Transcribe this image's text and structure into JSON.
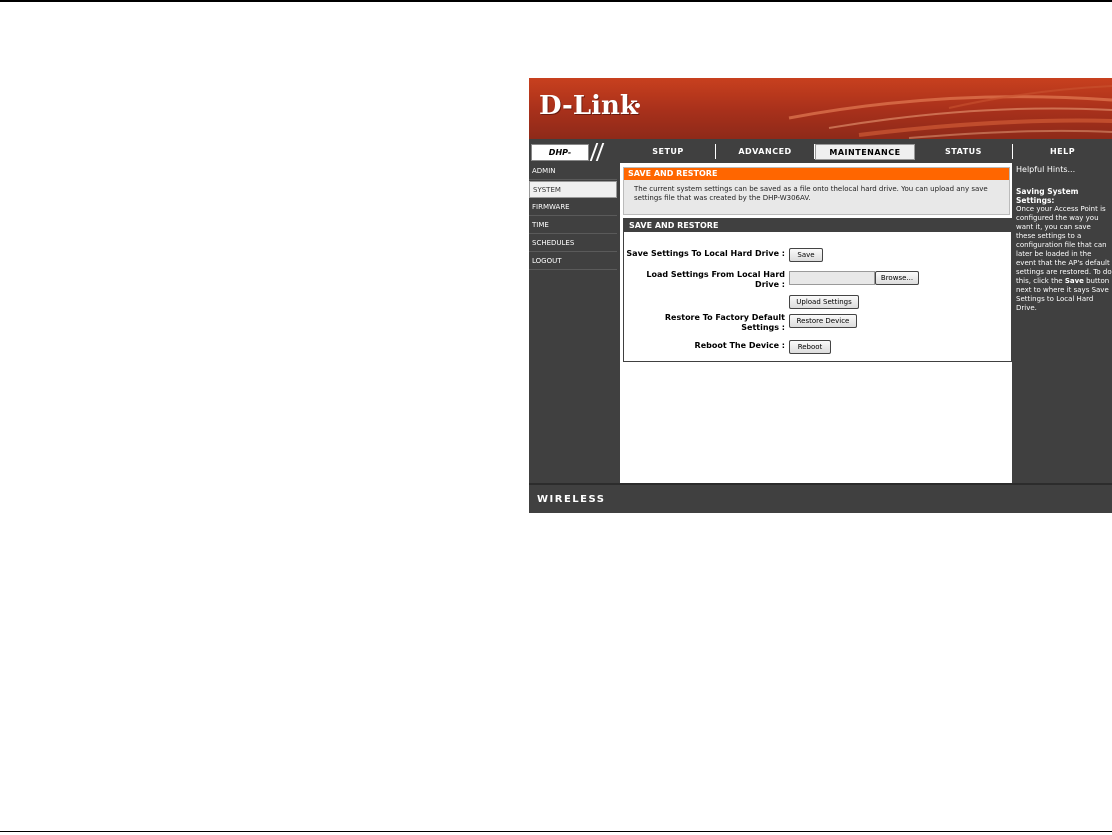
{
  "brand": {
    "logo": "D-Link",
    "footer": "WIRELESS"
  },
  "model": "DHP-W306AV",
  "tabs": [
    {
      "label": "SETUP"
    },
    {
      "label": "ADVANCED"
    },
    {
      "label": "MAINTENANCE"
    },
    {
      "label": "STATUS"
    },
    {
      "label": "HELP"
    }
  ],
  "sidebar": {
    "items": [
      {
        "label": "ADMIN"
      },
      {
        "label": "SYSTEM"
      },
      {
        "label": "FIRMWARE"
      },
      {
        "label": "TIME"
      },
      {
        "label": "SCHEDULES"
      },
      {
        "label": "LOGOUT"
      }
    ]
  },
  "intro": {
    "title": "SAVE AND RESTORE",
    "text": "The current system settings can be saved as a file onto thelocal hard drive. You can upload any save settings file that was created by the DHP-W306AV."
  },
  "form": {
    "title": "SAVE AND RESTORE",
    "save_label": "Save Settings To Local Hard Drive :",
    "save_button": "Save",
    "load_label_1": "Load Settings From Local Hard",
    "load_label_2": "Drive :",
    "file_value": "",
    "browse_button": "Browse...",
    "upload_button": "Upload Settings",
    "restore_label_1": "Restore To Factory Default",
    "restore_label_2": "Settings :",
    "restore_button": "Restore Device",
    "reboot_label": "Reboot The Device :",
    "reboot_button": "Reboot"
  },
  "help": {
    "title": "Helpful Hints...",
    "heading": "Saving System Settings:",
    "text_1": "Once your Access Point is configured the way you want it, you can save these settings to a configuration file that can later be loaded in the event that the AP's default settings are restored. To do this, click the ",
    "text_bold": "Save",
    "text_2": " button next to where it says Save Settings to Local Hard Drive."
  },
  "colors": {
    "banner": "#a7301b",
    "section_head": "#ff6600",
    "chrome": "#404040"
  }
}
